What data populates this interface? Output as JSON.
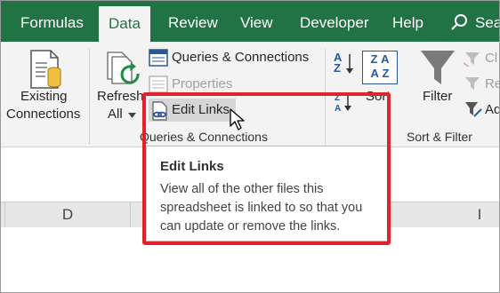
{
  "tabs": [
    {
      "label": "Formulas",
      "active": false
    },
    {
      "label": "Data",
      "active": true
    },
    {
      "label": "Review",
      "active": false
    },
    {
      "label": "View",
      "active": false
    },
    {
      "label": "Developer",
      "active": false
    },
    {
      "label": "Help",
      "active": false
    },
    {
      "label": "Sea",
      "active": false
    }
  ],
  "ribbon": {
    "existing_connections": {
      "line1": "Existing",
      "line2": "Connections"
    },
    "refresh_all": {
      "line1": "Refresh",
      "line2": "All"
    },
    "queries_connections": "Queries & Connections",
    "properties": "Properties",
    "edit_links": "Edit Links",
    "group_queries": "Queries & Connections",
    "sort": "Sort",
    "filter": "Filter",
    "group_sort_filter": "Sort & Filter",
    "clear_partial": "Cl",
    "reapply_partial": "Re",
    "advanced_partial": "Ad",
    "sort_az_top": "A",
    "sort_az_bottom": "Z",
    "sort_box_top": "Z",
    "sort_box_bottom": "A"
  },
  "columns": [
    "D",
    "I"
  ],
  "tooltip": {
    "title": "Edit Links",
    "body": "View all of the other files this spreadsheet is linked to so that you can update or remove the links."
  },
  "colors": {
    "accent": "#217346",
    "highlight": "#e0232f"
  }
}
